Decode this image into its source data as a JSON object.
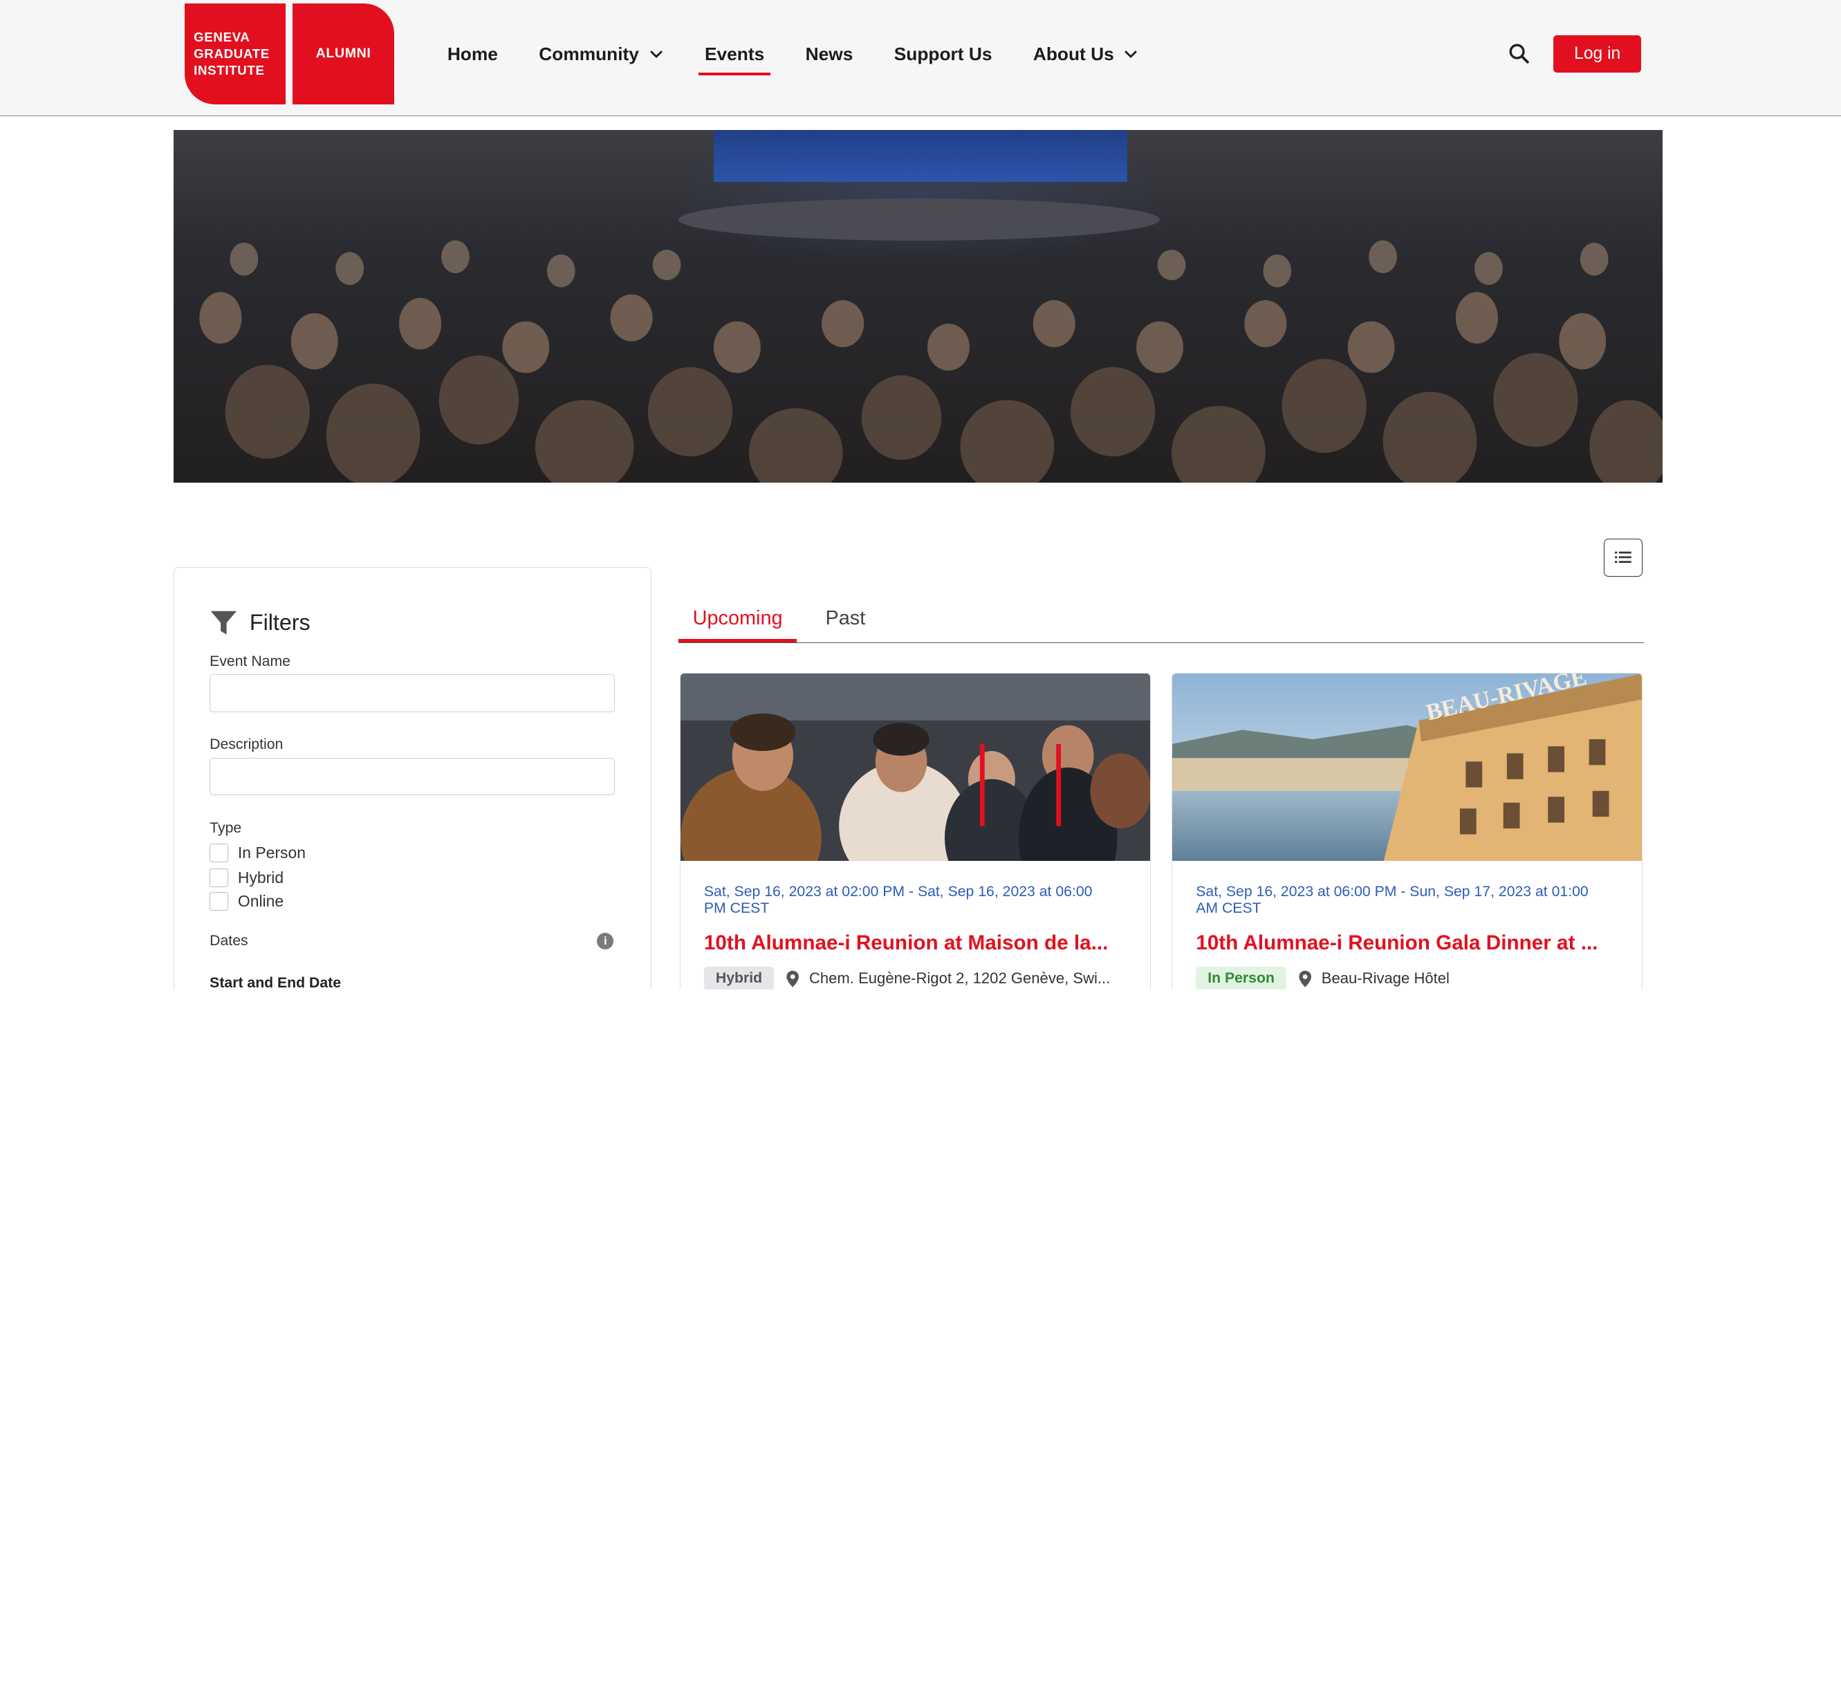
{
  "brand": {
    "logo_lines": [
      "GENEVA",
      "GRADUATE",
      "INSTITUTE"
    ],
    "alumni_label": "ALUMNI",
    "color": "#e2101f"
  },
  "nav": {
    "items": [
      {
        "label": "Home",
        "dropdown": false,
        "active": false
      },
      {
        "label": "Community",
        "dropdown": true,
        "active": false
      },
      {
        "label": "Events",
        "dropdown": false,
        "active": true
      },
      {
        "label": "News",
        "dropdown": false,
        "active": false
      },
      {
        "label": "Support Us",
        "dropdown": false,
        "active": false
      },
      {
        "label": "About Us",
        "dropdown": true,
        "active": false
      }
    ],
    "login_label": "Log in",
    "search_icon": "search-icon"
  },
  "filters": {
    "title": "Filters",
    "event_name_label": "Event Name",
    "event_name_value": "",
    "description_label": "Description",
    "description_value": "",
    "type_label": "Type",
    "type_options": [
      "In Person",
      "Hybrid",
      "Online"
    ],
    "dates_label": "Dates",
    "start_end_label": "Start and End Date"
  },
  "tabs": {
    "upcoming": "Upcoming",
    "past": "Past",
    "active": "Upcoming"
  },
  "events": [
    {
      "date": "Sat, Sep 16, 2023 at 02:00 PM - Sat, Sep 16, 2023 at 06:00 PM CEST",
      "title": "10th Alumnae-i Reunion at Maison de la...",
      "type": "Hybrid",
      "location": "Chem. Eugène-Rigot 2, 1202 Genève, Swi..."
    },
    {
      "date": "Sat, Sep 16, 2023 at 06:00 PM - Sun, Sep 17, 2023 at 01:00 AM CEST",
      "title": "10th Alumnae-i Reunion Gala Dinner at ...",
      "type": "In Person",
      "location": "Beau-Rivage Hôtel"
    }
  ],
  "hotel_sign": "BEAU-RIVAGE"
}
